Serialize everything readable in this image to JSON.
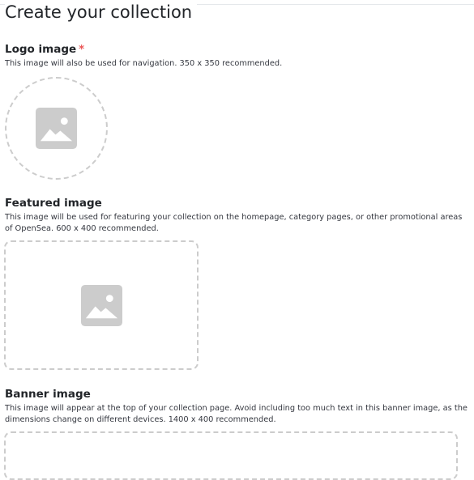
{
  "page": {
    "title": "Create your collection"
  },
  "logo": {
    "label": "Logo image",
    "required_mark": "*",
    "description": "This image will also be used for navigation. 350 x 350 recommended.",
    "icon": "image-placeholder-icon"
  },
  "featured": {
    "label": "Featured image",
    "description": "This image will be used for featuring your collection on the homepage, category pages, or other promotional areas of OpenSea. 600 x 400 recommended.",
    "icon": "image-placeholder-icon"
  },
  "banner": {
    "label": "Banner image",
    "description": "This image will appear at the top of your collection page. Avoid including too much text in this banner image, as the dimensions change on different devices. 1400 x 400 recommended."
  },
  "colors": {
    "dashed_border": "#cccccc",
    "icon_fill": "#cccccc",
    "required": "#eb5757",
    "heading": "#222529",
    "text": "#353840"
  }
}
